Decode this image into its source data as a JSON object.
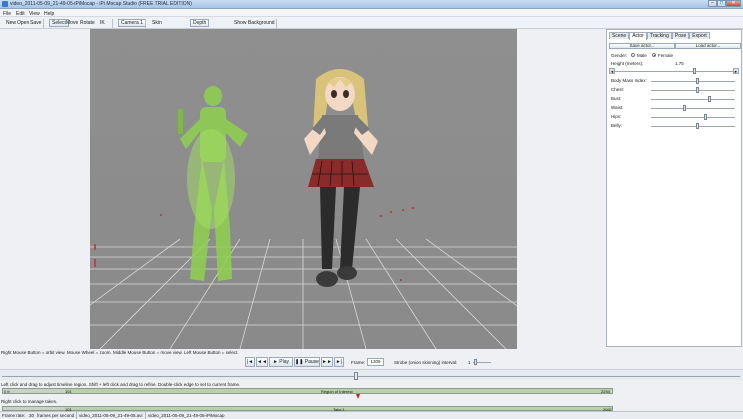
{
  "window": {
    "title": "video_2011-05-09_21-49-05-iPiMocap - iPi Mocap Studio (FREE TRIAL EDITION)",
    "minimize": "–",
    "maximize": "□",
    "close": "✕"
  },
  "menu": [
    "File",
    "Edit",
    "View",
    "Help"
  ],
  "toolbar": {
    "new": "New",
    "open": "Open",
    "save": "Save",
    "select": "Select",
    "move": "Move",
    "rotate": "Rotate",
    "ik": "IK",
    "camera": "Camera 1",
    "skin": "Skin",
    "depth": "Depth",
    "show_background": "Show Background"
  },
  "panel": {
    "tabs": [
      "Scene",
      "Actor",
      "Tracking",
      "Pose",
      "Export"
    ],
    "active_tab": "Actor",
    "save_actor": "Save actor...",
    "load_actor": "Load actor...",
    "gender_label": "Gender:",
    "male": "Male",
    "female": "Female",
    "gender_selected": "Female",
    "height_label": "Height (meters):",
    "height_value": "1.75",
    "height_scroll_left": "◄",
    "height_scroll_right": "►",
    "body_sliders": [
      {
        "label": "Body Mass Index:",
        "value": 0.55
      },
      {
        "label": "Chest:",
        "value": 0.55
      },
      {
        "label": "Bust:",
        "value": 0.7
      },
      {
        "label": "Waist:",
        "value": 0.4
      },
      {
        "label": "Hips:",
        "value": 0.65
      },
      {
        "label": "Belly:",
        "value": 0.55
      }
    ]
  },
  "hints": {
    "mouse": "Right Mouse Button = orbit view. Mouse Wheel = zoom. Middle Mouse Button = move view. Left Mouse Button = select.",
    "timeline": "Left click and drag to adjust timeline region. Shift + left click and drag to refine. Double-click edge to set to current frame.",
    "takes": "Right click to manage takes."
  },
  "transport": {
    "first": "|◄",
    "prev": "◄◄",
    "play": "► Play",
    "pause": "❚❚ Pause",
    "next": "►►",
    "last": "►|",
    "frame_label": "Frame:",
    "frame_value": "1309",
    "strobe_label": "Strobe (onion skinning) interval:",
    "strobe_value": "1"
  },
  "timeline": {
    "region_label": "Region of Interest",
    "region_start": "0 fr",
    "region_left": "101",
    "region_end": "2294",
    "take_label": "Take 1",
    "take_left": "101",
    "take_end": "2097"
  },
  "status": {
    "frame_rate_label": "Frame rate:",
    "frame_rate_value": "30",
    "fps_unit": "frames per second",
    "video_file": "video_2011-05-09_21-49-05.avi",
    "project_file": "video_2011-05-09_21-49-05-iPiMocap"
  }
}
